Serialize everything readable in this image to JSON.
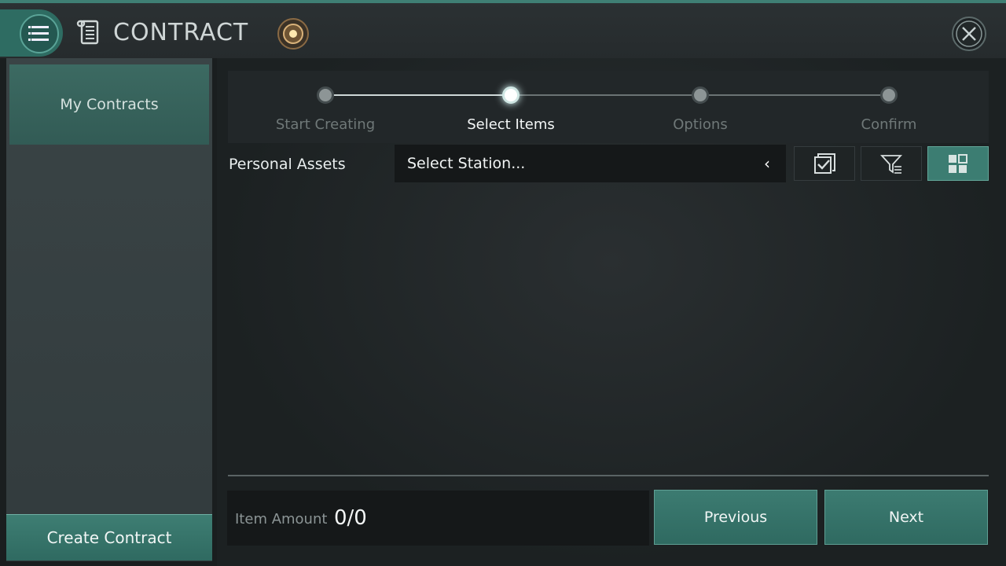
{
  "header": {
    "title": "CONTRACT",
    "icons": [
      "menu-icon",
      "scroll-icon",
      "medal-icon",
      "close-icon"
    ]
  },
  "sidebar": {
    "tab_label": "My Contracts",
    "create_button": "Create Contract"
  },
  "steps": [
    {
      "label": "Start Creating",
      "state": "done"
    },
    {
      "label": "Select Items",
      "state": "active"
    },
    {
      "label": "Options",
      "state": "pending"
    },
    {
      "label": "Confirm",
      "state": "pending"
    }
  ],
  "assets": {
    "label": "Personal Assets",
    "station_select": "Select Station..."
  },
  "toolbar": {
    "icons": [
      "select-all-icon",
      "filter-icon",
      "grid-view-icon"
    ]
  },
  "footer": {
    "item_amount_label": "Item Amount",
    "item_amount_value": "0/0",
    "previous_button": "Previous",
    "next_button": "Next"
  },
  "colors": {
    "accent": "#3c7d72",
    "background": "#1a1e1f",
    "highlight_box": "#e01818"
  }
}
